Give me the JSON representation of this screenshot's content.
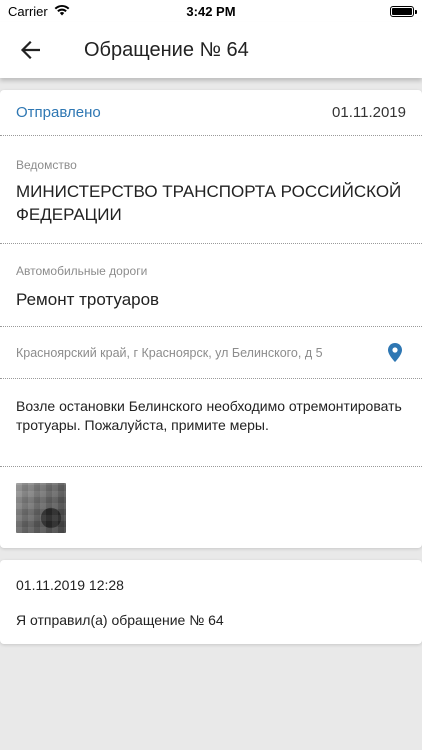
{
  "status_bar": {
    "carrier": "Carrier",
    "time": "3:42 PM",
    "icons": [
      "wifi-icon",
      "battery-icon"
    ]
  },
  "nav": {
    "back_icon": "arrow-left-icon",
    "title": "Обращение № 64"
  },
  "appeal": {
    "status": "Отправлено",
    "date": "01.11.2019",
    "agency_label": "Ведомство",
    "agency_value": "МИНИСТЕРСТВО ТРАНСПОРТА РОССИЙСКОЙ ФЕДЕРАЦИИ",
    "category_label": "Автомобильные дороги",
    "category_value": "Ремонт тротуаров",
    "address": "Красноярский край, г Красноярск, ул Белинского, д 5",
    "address_icon": "map-pin-icon",
    "description": "Возле остановки Белинского необходимо отремонтировать тротуары. Пожалуйста, примите меры.",
    "photos": [
      "photo-thumbnail"
    ]
  },
  "history": {
    "datetime": "01.11.2019 12:28",
    "text": "Я отправил(а) обращение № 64"
  },
  "colors": {
    "accent": "#2e77b3",
    "background": "#e9e9e9",
    "label": "#8c8c8c"
  }
}
